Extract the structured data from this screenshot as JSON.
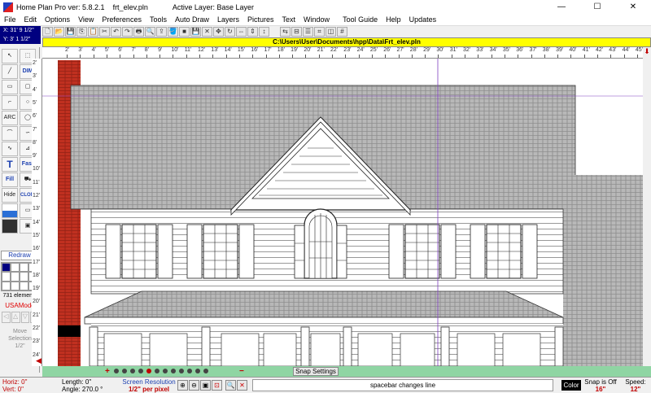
{
  "window": {
    "app_title": "Home Plan Pro ver: 5.8.2.1",
    "file_name": "frt_elev.pln",
    "active_layer": "Active Layer: Base Layer",
    "controls": [
      "—",
      "☐",
      "✕"
    ]
  },
  "menu": [
    "File",
    "Edit",
    "Options",
    "View",
    "Preferences",
    "Tools",
    "Auto Draw",
    "Layers",
    "Pictures",
    "Text",
    "Window",
    "Tool Guide",
    "Help",
    "Updates"
  ],
  "coords": {
    "x": "X: 31' 9 1/2\"",
    "y": "Y: 3' 1 1/2\""
  },
  "path": "C:\\Users\\User\\Documents\\hpp\\Data\\Frt_elev.pln",
  "toolbar_icons": [
    "new-icon",
    "open-icon",
    "save-icon",
    "copy-icon",
    "paste-icon",
    "cut-icon",
    "undo-icon",
    "redo-icon",
    "print-icon",
    "preview-icon",
    "export-icon",
    "fill-icon",
    "stop-icon",
    "save-red-icon",
    "delete-icon",
    "move-icon",
    "rotate-icon",
    "stretch-icon",
    "scale-h-icon",
    "scale-v-icon",
    "sep",
    "sep",
    "flip-icon",
    "mirror-icon",
    "align-icon",
    "snap-icon",
    "layer-icon",
    "grid-icon"
  ],
  "left_tools": {
    "dim_label": "DIM",
    "arc_label": "ARC",
    "fast_label": "Fast",
    "fill_label": "Fill",
    "hide_label": "Hide",
    "clone_label": "CLONE",
    "redraw": "Redraw",
    "element_count": "731 elements",
    "mode": "USAMode",
    "move_selection": [
      "Move",
      "Selection",
      "1/2\""
    ]
  },
  "ruler": {
    "h_labels": [
      "2'",
      "3'",
      "4'",
      "5'",
      "6'",
      "7'",
      "8'",
      "9'",
      "10'",
      "11'",
      "12'",
      "13'",
      "14'",
      "15'",
      "16'",
      "17'",
      "18'",
      "19'",
      "20'",
      "21'",
      "22'",
      "23'",
      "24'",
      "25'",
      "26'",
      "27'",
      "28'",
      "29'",
      "30'",
      "31'",
      "32'",
      "33'",
      "34'",
      "35'",
      "36'",
      "37'",
      "38'",
      "39'",
      "40'",
      "41'",
      "42'",
      "43'",
      "44'",
      "45'",
      "46'",
      "47'",
      "48'"
    ],
    "v_labels": [
      "2'",
      "3'",
      "4'",
      "5'",
      "6'",
      "7'",
      "8'",
      "9'",
      "10'",
      "11'",
      "12'",
      "13'",
      "14'",
      "15'",
      "16'",
      "17'",
      "18'",
      "19'",
      "20'",
      "21'",
      "22'",
      "23'",
      "24'"
    ]
  },
  "snap_settings": "Snap Settings",
  "status": {
    "horiz": "Horiz: 0\"",
    "vert": "Vert: 0\"",
    "length": "Length: 0\"",
    "angle": "Angle: 270.0 °",
    "screen_res_label": "Screen Resolution",
    "screen_res_value": "1/2\" per pixel",
    "hint": "spacebar changes line",
    "color_btn": "Color",
    "snap_label": "Snap is Off",
    "snap_value": "16\"",
    "speed_label": "Speed:",
    "speed_value": "12\""
  },
  "colors": {
    "path_bar": "#ffff00",
    "scroll_strip": "#8fd5a3",
    "brick": "#c03020",
    "accent_red": "#c00000",
    "accent_blue": "#1b3fb0"
  }
}
